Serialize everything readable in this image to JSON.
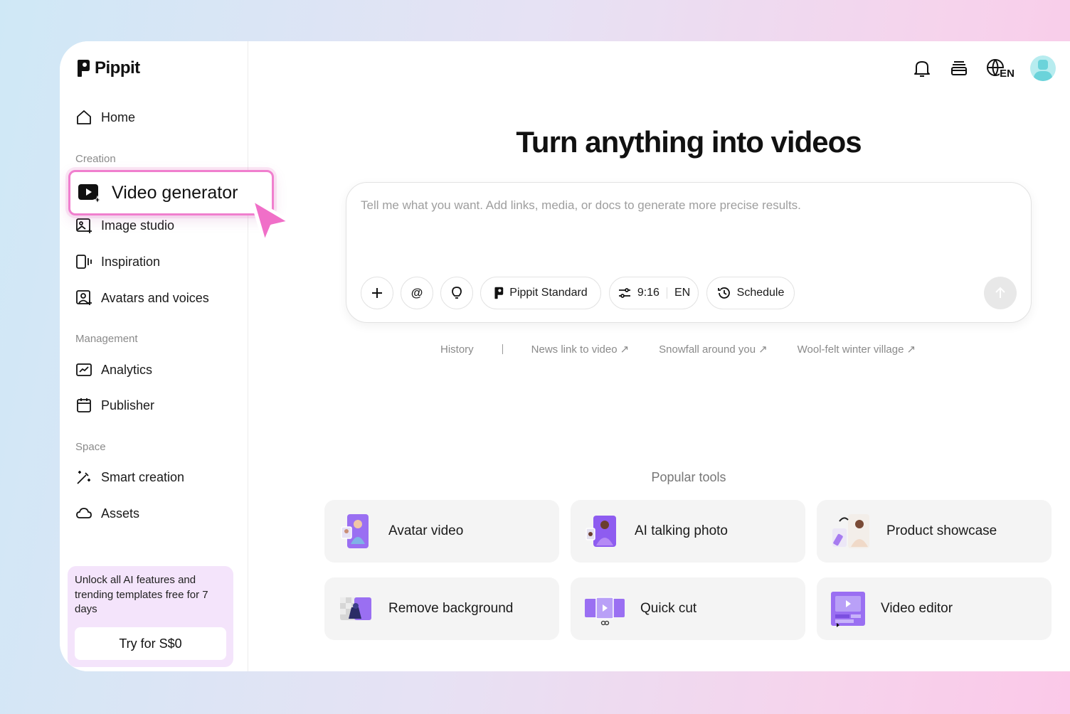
{
  "brand": {
    "name": "Pippit"
  },
  "sidebar": {
    "home": "Home",
    "sections": {
      "creation": "Creation",
      "management": "Management",
      "space": "Space"
    },
    "items": {
      "video_generator": "Video generator",
      "image_studio": "Image studio",
      "inspiration": "Inspiration",
      "avatars_voices": "Avatars and voices",
      "analytics": "Analytics",
      "publisher": "Publisher",
      "smart_creation": "Smart creation",
      "assets": "Assets"
    },
    "promo": {
      "text": "Unlock all AI features and trending templates free for 7 days",
      "button": "Try for S$0"
    }
  },
  "topbar": {
    "language": "EN"
  },
  "main": {
    "headline": "Turn anything into videos",
    "prompt_placeholder": "Tell me what you want. Add links, media, or docs to generate more precise results.",
    "toolbar": {
      "model": "Pippit Standard",
      "ratio": "9:16",
      "language": "EN",
      "schedule": "Schedule"
    },
    "suggestions": {
      "history": "History",
      "items": [
        "News link to video",
        "Snowfall around you",
        "Wool-felt winter village"
      ]
    },
    "popular_title": "Popular tools",
    "tools": [
      "Avatar video",
      "AI talking photo",
      "Product showcase",
      "Remove background",
      "Quick cut",
      "Video editor"
    ]
  },
  "colors": {
    "accent_pink": "#f07fce",
    "purple": "#8e5cf0"
  }
}
